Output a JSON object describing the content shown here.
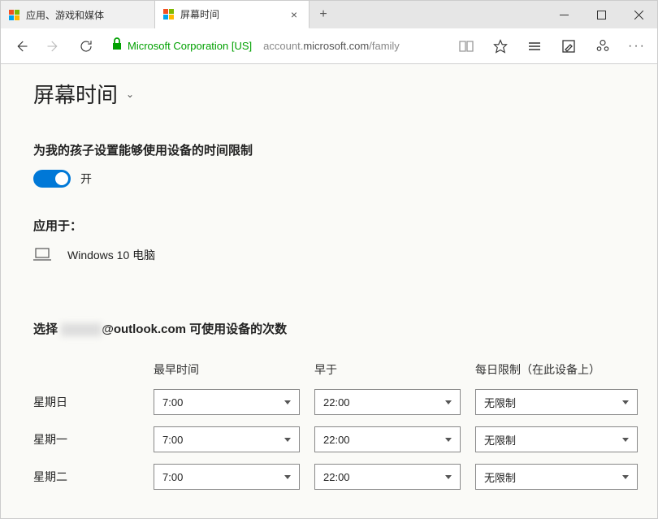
{
  "tabs": [
    {
      "title": "应用、游戏和媒体"
    },
    {
      "title": "屏幕时间"
    }
  ],
  "cert_name": "Microsoft Corporation [US]",
  "url_host": "microsoft.com",
  "url_prefix": "account.",
  "url_suffix": "/family",
  "page_title": "屏幕时间",
  "limits_heading": "为我的孩子设置能够使用设备的时间限制",
  "toggle_state": "开",
  "applies_heading": "应用于：",
  "device_name": "Windows 10 电脑",
  "schedule_prefix": "选择",
  "schedule_email": "@outlook.com",
  "schedule_suffix": "可使用设备的次数",
  "columns": {
    "earliest": "最早时间",
    "latest": "早于",
    "daily": "每日限制（在此设备上）"
  },
  "rows": [
    {
      "day": "星期日",
      "from": "7:00",
      "to": "22:00",
      "limit": "无限制"
    },
    {
      "day": "星期一",
      "from": "7:00",
      "to": "22:00",
      "limit": "无限制"
    },
    {
      "day": "星期二",
      "from": "7:00",
      "to": "22:00",
      "limit": "无限制"
    }
  ]
}
